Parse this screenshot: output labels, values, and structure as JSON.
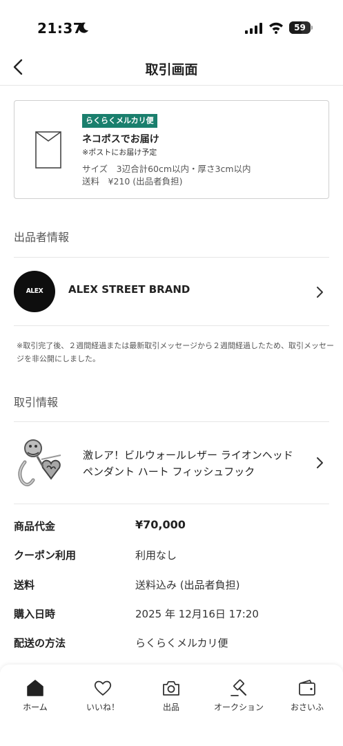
{
  "status_bar": {
    "time": "21:37",
    "battery": "59",
    "battery_level": 0.59
  },
  "header": {
    "title": "取引画面"
  },
  "shipping": {
    "badge": "らくらくメルカリ便",
    "method": "ネコポスでお届け",
    "note": "※ポストにお届け予定",
    "size": "サイズ　3辺合計60cm以内・厚さ3cm以内",
    "fee": "送料　¥210 (出品者負担)"
  },
  "seller_section": {
    "heading": "出品者情報",
    "avatar_text": "ALEX STREET",
    "name": "ALEX STREET BRAND"
  },
  "notice": "※取引完了後、２週間経過または最新取引メッセージから２週間経過したため、取引メッセージを非公開にしました。",
  "transaction_section": {
    "heading": "取引情報",
    "product_title": "激レア！ビルウォールレザー ライオンヘッド ペンダント ハート フィッシュフック"
  },
  "info": [
    {
      "label": "商品代金",
      "value": "¥70,000"
    },
    {
      "label": "クーポン利用",
      "value": "利用なし"
    },
    {
      "label": "送料",
      "value": "送料込み (出品者負担)"
    },
    {
      "label": "購入日時",
      "value": "2025 年 12月16日 17:20"
    },
    {
      "label": "配送の方法",
      "value": "らくらくメルカリ便"
    }
  ],
  "tabs": [
    {
      "label": "ホーム",
      "icon": "home-icon"
    },
    {
      "label": "いいね！",
      "icon": "heart-icon"
    },
    {
      "label": "出品",
      "icon": "camera-icon"
    },
    {
      "label": "オークション",
      "icon": "gavel-icon"
    },
    {
      "label": "おさいふ",
      "icon": "wallet-icon"
    }
  ],
  "colors": {
    "badge": "#1a7f6d",
    "text": "#222222"
  }
}
